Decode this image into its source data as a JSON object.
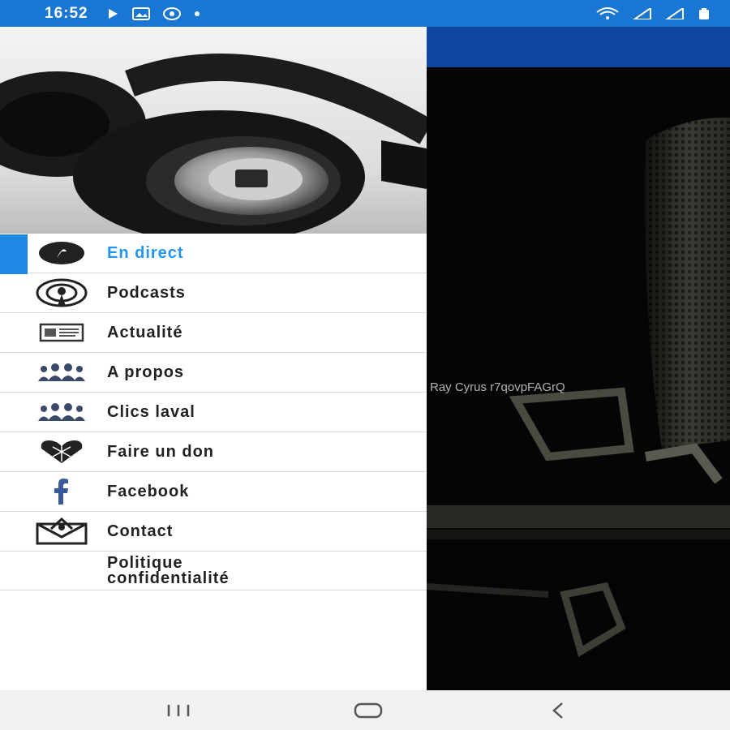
{
  "status_bar": {
    "time": "16:52",
    "icons": [
      "play-icon",
      "gallery-icon",
      "vpn-icon",
      "dot-icon"
    ],
    "right_icons": [
      "wifi-icon",
      "signal-icon",
      "signal-icon",
      "battery-icon"
    ]
  },
  "header": {
    "image": "headphones-image"
  },
  "menu": {
    "items": [
      {
        "label": "En direct",
        "icon": "live-icon",
        "active": true
      },
      {
        "label": "Podcasts",
        "icon": "podcast-icon"
      },
      {
        "label": "Actualité",
        "icon": "news-icon"
      },
      {
        "label": "A propos",
        "icon": "people-icon"
      },
      {
        "label": "Clics laval",
        "icon": "people-icon"
      },
      {
        "label": "Faire un don",
        "icon": "heart-icon"
      },
      {
        "label": "Facebook",
        "icon": "facebook-icon"
      },
      {
        "label": "Contact",
        "icon": "mail-icon"
      },
      {
        "label": "Politique confidentialité",
        "icon": ""
      }
    ]
  },
  "content": {
    "now_playing": "Ray Cyrus r7qovpFAGrQ",
    "image": "microphone-image"
  },
  "nav_bar": {
    "buttons": [
      "recents-button",
      "home-button",
      "back-button"
    ]
  },
  "colors": {
    "status_bar": "#1976d2",
    "toolbar": "#0d47a1",
    "accent": "#2196f3"
  }
}
